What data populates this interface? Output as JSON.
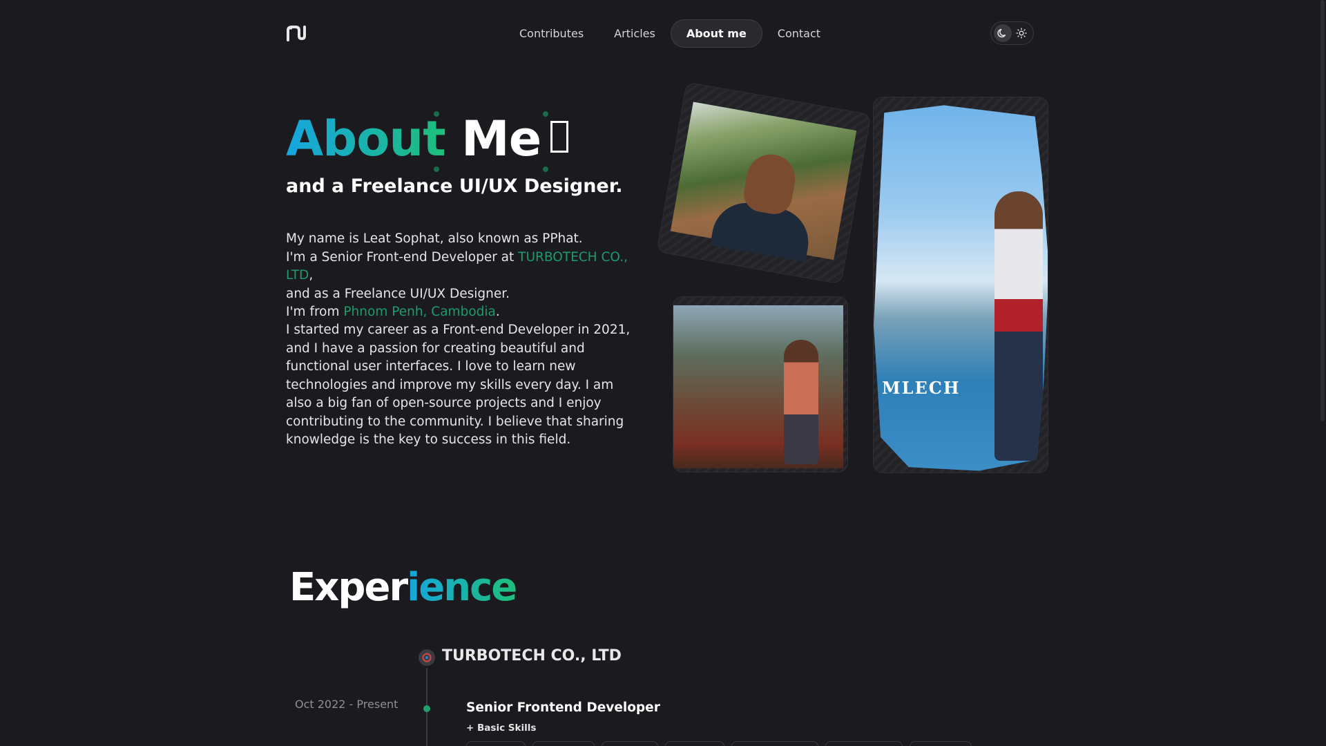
{
  "nav": {
    "items": [
      {
        "label": "Contributes"
      },
      {
        "label": "Articles"
      },
      {
        "label": "About me",
        "active": true
      },
      {
        "label": "Contact"
      }
    ]
  },
  "theme": {
    "dark_icon": "moon-icon",
    "light_icon": "sun-icon",
    "selected": "dark"
  },
  "hero": {
    "title_word1": "About",
    "title_word2": "Me",
    "subtitle": "and a Freelance UI/UX Designer.",
    "intro": {
      "line1": "My name is Leat Sophat, also known as PPhat.",
      "line2_prefix": "I'm a Senior Front-end Developer at ",
      "company_link": "TURBOTECH CO., LTD",
      "line2_suffix": ",",
      "line3": "and as a Freelance UI/UX Designer.",
      "line4_prefix": "I'm from ",
      "location_link": "Phnom Penh, Cambodia",
      "line4_suffix": "."
    },
    "bio": "I started my career as a Front-end Developer in 2021, and I have a passion for creating beautiful and functional user interfaces. I love to learn new technologies and improve my skills every day. I am also a big fan of open-source projects and I enjoy contributing to the community. I believe that sharing knowledge is the key to success in this field."
  },
  "photos": {
    "sign_text": "MLECH"
  },
  "experience": {
    "title_part1": "Exper",
    "title_part2": "ience",
    "company": "TURBOTECH CO., LTD",
    "date": "Oct 2022 - Present",
    "role": "Senior Frontend Developer",
    "skills_toggle": "+ Basic Skills"
  },
  "colors": {
    "accent_green": "#1d9b6b",
    "accent_blue": "#15a6e0",
    "background": "#1b1b1f"
  }
}
